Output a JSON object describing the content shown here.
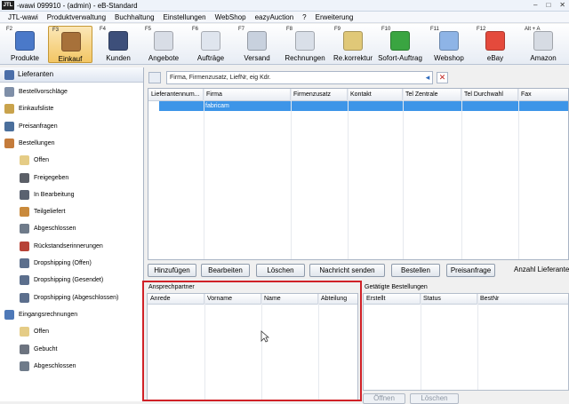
{
  "window": {
    "logo": "JTL",
    "title": "-wawi 099910 - (admin) - eB-Standard",
    "controls": [
      "–",
      "□",
      "✕"
    ]
  },
  "menu": [
    "JTL-wawi",
    "Produktverwaltung",
    "Buchhaltung",
    "Einstellungen",
    "WebShop",
    "eazyAuction",
    "?",
    "Erweiterung"
  ],
  "toolbar": [
    {
      "key": "F2",
      "label": "Produkte",
      "icon": "pencil-icon",
      "color": "#4a79c9"
    },
    {
      "key": "F3",
      "label": "Einkauf",
      "icon": "crate-icon",
      "color": "#a7713a",
      "active": true
    },
    {
      "key": "F4",
      "label": "Kunden",
      "icon": "user-icon",
      "color": "#3d4f7a"
    },
    {
      "key": "F5",
      "label": "Angebote",
      "icon": "offer-sheet-icon",
      "color": "#d8dde6"
    },
    {
      "key": "F6",
      "label": "Aufträge",
      "icon": "order-sheet-icon",
      "color": "#dfe5ee"
    },
    {
      "key": "F7",
      "label": "Versand",
      "icon": "shipping-icon",
      "color": "#c8d1de"
    },
    {
      "key": "F8",
      "label": "Rechnungen",
      "icon": "invoice-icon",
      "color": "#d9dfe8"
    },
    {
      "key": "F9",
      "label": "Re.korrektur",
      "icon": "correction-icon",
      "color": "#e0c878"
    },
    {
      "key": "F10",
      "label": "Sofort-Auftrag",
      "icon": "star-icon",
      "color": "#3aa541"
    },
    {
      "key": "F11",
      "label": "Webshop",
      "icon": "cloud-icon",
      "color": "#8eb4e6"
    },
    {
      "key": "F12",
      "label": "eBay",
      "icon": "ebay-icon",
      "color": "#e44a3c"
    },
    {
      "key": "Alt + A",
      "label": "Amazon",
      "icon": "amazon-icon",
      "color": "#d6dbe3"
    }
  ],
  "nav": {
    "header": "Lieferanten",
    "items": [
      {
        "label": "Bestellvorschläge",
        "icon": "proposal-icon",
        "color": "#7f8fa8",
        "level": 0
      },
      {
        "label": "Einkaufsliste",
        "icon": "list-icon",
        "color": "#c9a34c",
        "level": 0
      },
      {
        "label": "Preisanfragen",
        "icon": "price-request-icon",
        "color": "#4b6f9c",
        "level": 0
      },
      {
        "label": "Bestellungen",
        "icon": "orders-icon",
        "color": "#c47b3b",
        "level": 0
      },
      {
        "label": "Offen",
        "icon": "open-icon",
        "color": "#e5cc86",
        "level": 1
      },
      {
        "label": "Freigegeben",
        "icon": "released-icon",
        "color": "#5b5f67",
        "level": 1
      },
      {
        "label": "In Bearbeitung",
        "icon": "in-progress-icon",
        "color": "#5a6270",
        "level": 1
      },
      {
        "label": "Teilgeliefert",
        "icon": "partial-icon",
        "color": "#c98a3c",
        "level": 1
      },
      {
        "label": "Abgeschlossen",
        "icon": "done-icon",
        "color": "#6f7b8a",
        "level": 1
      },
      {
        "label": "Rückstandserinnerungen",
        "icon": "reminder-icon",
        "color": "#b74237",
        "level": 1
      },
      {
        "label": "Dropshipping (Offen)",
        "icon": "dropship-open-icon",
        "color": "#5c6f8d",
        "level": 1
      },
      {
        "label": "Dropshipping (Gesendet)",
        "icon": "dropship-sent-icon",
        "color": "#5c6f8d",
        "level": 1
      },
      {
        "label": "Dropshipping (Abgeschlossen)",
        "icon": "dropship-done-icon",
        "color": "#5c6f8d",
        "level": 1
      },
      {
        "label": "Eingangsrechnungen",
        "icon": "incoming-invoice-icon",
        "color": "#4e79b8",
        "level": 0
      },
      {
        "label": "Offen",
        "icon": "open-icon",
        "color": "#e5cc86",
        "level": 1
      },
      {
        "label": "Gebucht",
        "icon": "booked-icon",
        "color": "#6d7480",
        "level": 1
      },
      {
        "label": "Abgeschlossen",
        "icon": "done-icon",
        "color": "#6f7b8a",
        "level": 1
      }
    ]
  },
  "search": {
    "placeholder": "Firma, Firmenzusatz, LiefNr, eig Kdr.",
    "value": "Firma, Firmenzusatz, LiefNr, eig Kdr."
  },
  "supplier_table": {
    "columns": [
      "Lieferantennum...",
      "Firma",
      "Firmenzusatz",
      "Kontakt",
      "Tel Zentrale",
      "Tel Durchwahl",
      "Fax"
    ],
    "selected_row": {
      "firma": "fabricam"
    }
  },
  "actions": {
    "buttons": [
      "Hinzufügen",
      "Bearbeiten",
      "Löschen",
      "Nachricht senden",
      "Bestellen",
      "Preisanfrage"
    ],
    "count_label": "Anzahl Lieferanten:"
  },
  "contacts": {
    "title": "Ansprechpartner",
    "columns": [
      "Anrede",
      "Vorname",
      "Name",
      "Abteilung"
    ]
  },
  "orders": {
    "title": "Getätigte Bestellungen",
    "columns": [
      "Erstellt",
      "Status",
      "BestNr"
    ],
    "buttons": [
      "Öffnen",
      "Löschen"
    ]
  },
  "colors": {
    "selection": "#3d95e8",
    "highlight_frame": "#d02127",
    "toolbar_active": "#f3c664"
  }
}
